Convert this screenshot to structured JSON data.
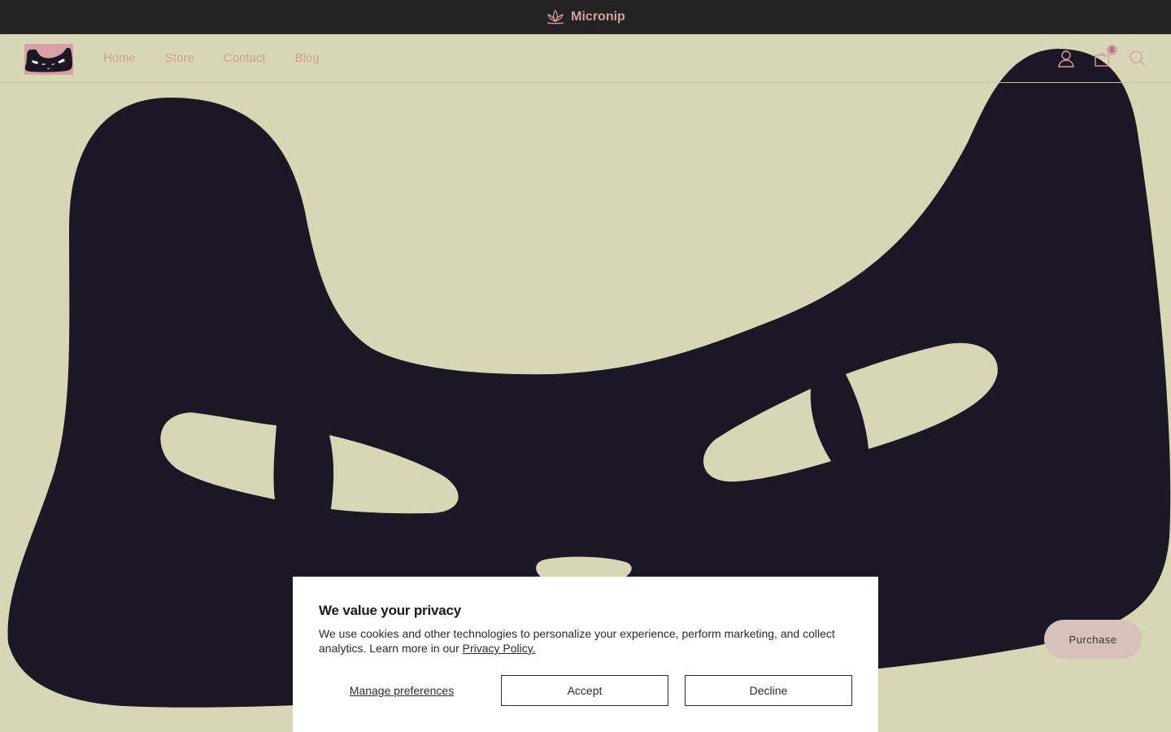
{
  "announcement": {
    "brand": "Micronip"
  },
  "nav": {
    "items": [
      "Home",
      "Store",
      "Contact",
      "Blog"
    ]
  },
  "header": {
    "cart_count": "0"
  },
  "hero": {
    "bg_color": "#d7d6b5",
    "shape_color": "#1b1724"
  },
  "purchase": {
    "label": "Purchase"
  },
  "cookie": {
    "title": "We value your privacy",
    "body": "We use cookies and other technologies to personalize your experience, perform marketing, and collect analytics. Learn more in our ",
    "link": "Privacy Policy.",
    "manage_label": "Manage preferences",
    "accept_label": "Accept",
    "decline_label": "Decline"
  }
}
